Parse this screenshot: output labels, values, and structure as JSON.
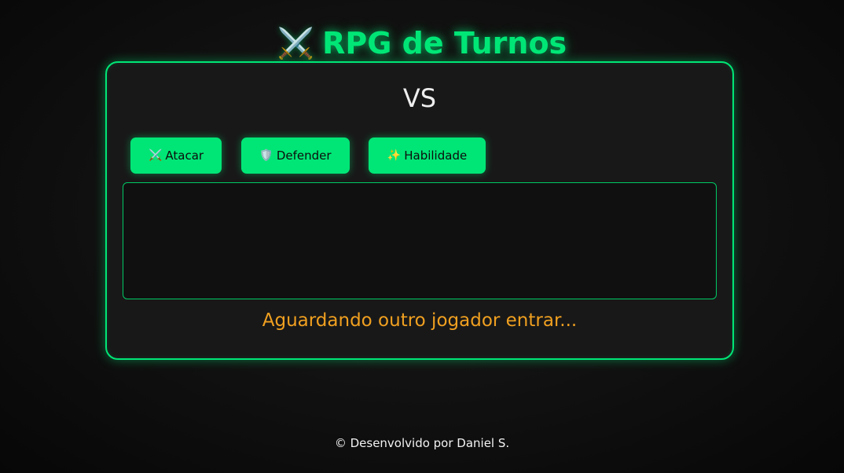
{
  "header": {
    "title_icon": "⚔️",
    "title": "RPG de Turnos"
  },
  "battle": {
    "vs_label": "VS",
    "actions": [
      {
        "icon": "⚔️",
        "icon_name": "crossed-swords-icon",
        "label": "Atacar"
      },
      {
        "icon": "🛡️",
        "icon_name": "shield-icon",
        "label": "Defender"
      },
      {
        "icon": "✨",
        "icon_name": "sparkles-icon",
        "label": "Habilidade"
      }
    ],
    "log_text": "",
    "status_text": "Aguardando outro jogador entrar..."
  },
  "footer": {
    "text": "© Desenvolvido por Daniel S."
  },
  "colors": {
    "accent": "#00e676",
    "status": "#f0a020",
    "background": "#121212",
    "panel": "#181818"
  }
}
